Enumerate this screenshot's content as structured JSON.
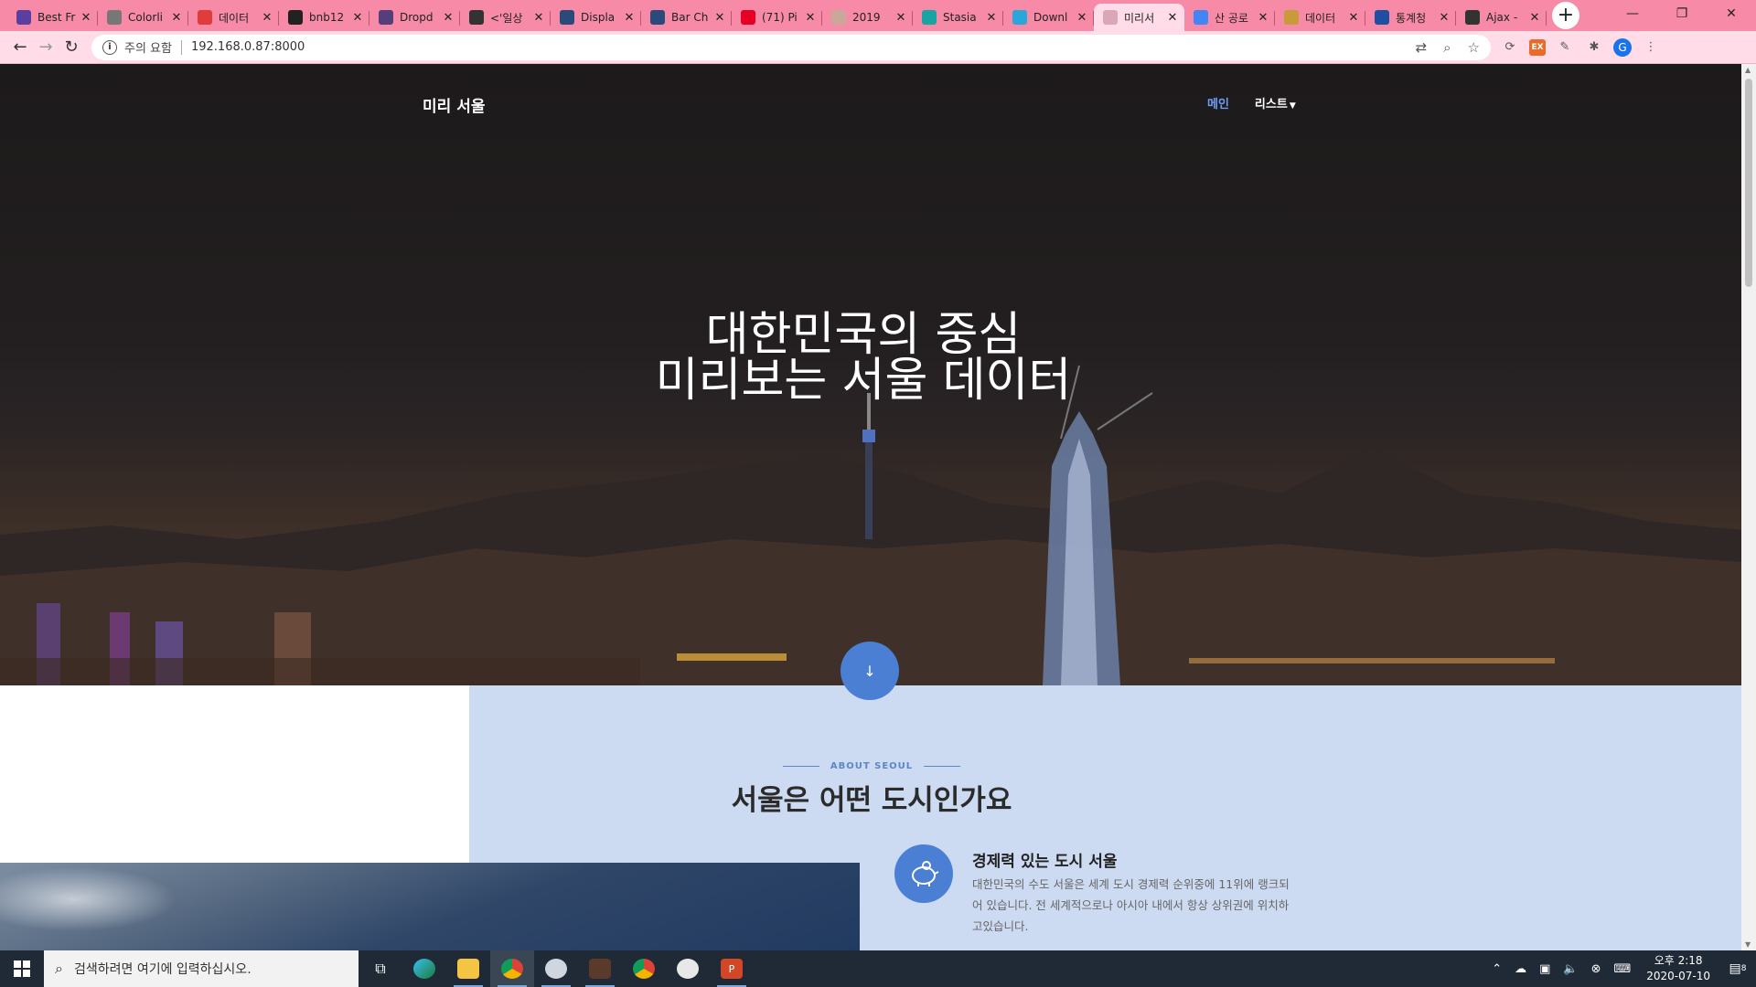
{
  "browser": {
    "tabs": [
      {
        "title": "Best Fr",
        "fav_color": "#5a3fa0",
        "fav_icon": "brand-icon"
      },
      {
        "title": "Colorli",
        "fav_color": "#777777",
        "fav_icon": "wordpress-icon"
      },
      {
        "title": "데이터",
        "fav_color": "#e03c3c",
        "fav_icon": "circle-icon"
      },
      {
        "title": "bnb12",
        "fav_color": "#222222",
        "fav_icon": "github-icon"
      },
      {
        "title": "Dropd",
        "fav_color": "#563d7c",
        "fav_icon": "bootstrap-icon"
      },
      {
        "title": "<'일상",
        "fav_color": "#333333",
        "fav_icon": "dots-icon"
      },
      {
        "title": "Displa",
        "fav_color": "#2a4a7a",
        "fav_icon": "chart-icon"
      },
      {
        "title": "Bar Ch",
        "fav_color": "#2a4a7a",
        "fav_icon": "chart-icon"
      },
      {
        "title": "(71) Pi",
        "fav_color": "#e60023",
        "fav_icon": "pinterest-icon"
      },
      {
        "title": "2019",
        "fav_color": "#c9a89a",
        "fav_icon": "circle-icon"
      },
      {
        "title": "Stasia",
        "fav_color": "#1aa3a3",
        "fav_icon": "globe-icon"
      },
      {
        "title": "Downl",
        "fav_color": "#2aa6d9",
        "fav_icon": "f-icon"
      },
      {
        "title": "미리서",
        "fav_color": "#d9a7b5",
        "fav_icon": "globe-icon",
        "active": true
      },
      {
        "title": "산 공로",
        "fav_color": "#4285f4",
        "fav_icon": "google-icon"
      },
      {
        "title": "데이터",
        "fav_color": "#c99a3a",
        "fav_icon": "puzzle-icon"
      },
      {
        "title": "통계청",
        "fav_color": "#1f4fa0",
        "fav_icon": "korea-icon"
      },
      {
        "title": "Ajax -",
        "fav_color": "#333333",
        "fav_icon": "wikipedia-icon"
      }
    ],
    "omnibox": {
      "security_label": "주의 요함",
      "url": "192.168.0.87:8000"
    }
  },
  "site": {
    "brand": "미리 서울",
    "nav": {
      "main": "메인",
      "list": "리스트"
    },
    "hero": {
      "line1": "대한민국의 중심",
      "line2": "미리보는 서울 데이터"
    },
    "about": {
      "label": "ABOUT SEOUL",
      "title": "서울은 어떤 도시인가요",
      "feature": {
        "title": "경제력 있는 도시 서울",
        "text": "대한민국의 수도 서울은 세계 도시 경제력 순위중에 11위에 랭크되어 있습니다. 전 세계적으로나 아시아 내에서 항상 상위권에 위치하고있습니다."
      }
    }
  },
  "taskbar": {
    "search_placeholder": "검색하려면 여기에 입력하십시오.",
    "clock_time": "오후 2:18",
    "clock_date": "2020-07-10",
    "notification_count": "8"
  },
  "colors": {
    "accent": "#4a7fd4",
    "about_bg": "#ccdaf2",
    "tab_strip": "#f78aa6"
  }
}
